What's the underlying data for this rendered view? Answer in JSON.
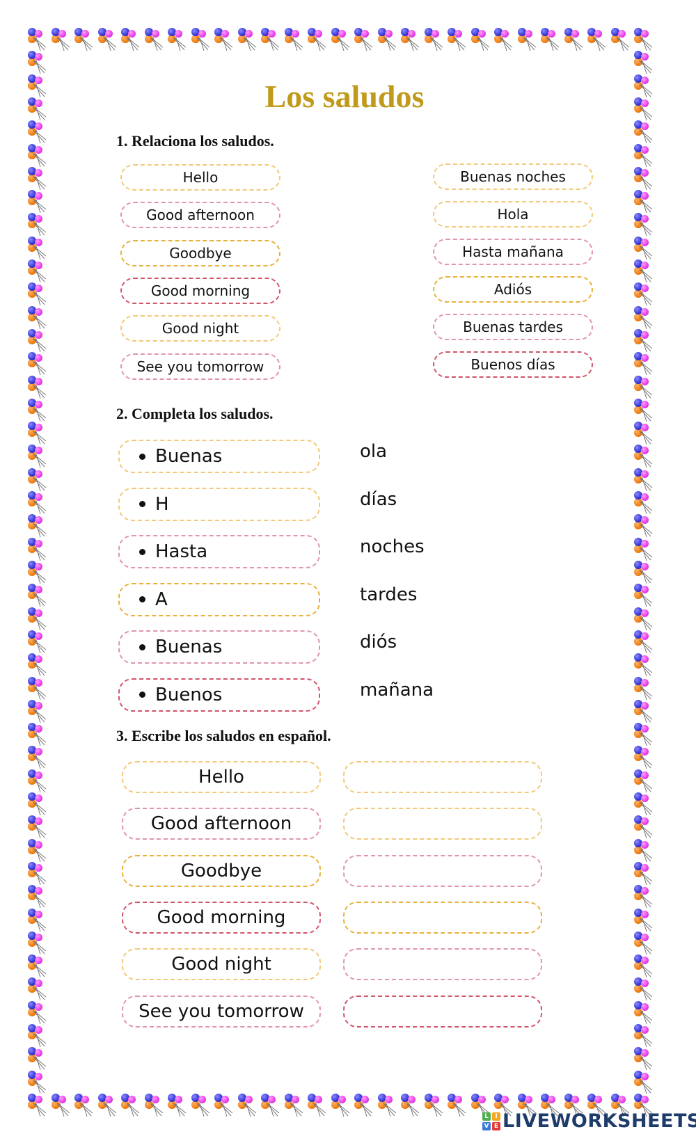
{
  "title": "Los saludos",
  "section1": {
    "heading": "1. Relaciona los saludos.",
    "left": [
      {
        "label": "Hello",
        "color": "yellow"
      },
      {
        "label": "Good afternoon",
        "color": "pink"
      },
      {
        "label": "Goodbye",
        "color": "gold"
      },
      {
        "label": "Good morning",
        "color": "red"
      },
      {
        "label": "Good night",
        "color": "yellow"
      },
      {
        "label": "See you tomorrow",
        "color": "pink"
      }
    ],
    "right": [
      {
        "label": "Buenas noches",
        "color": "yellow"
      },
      {
        "label": "Hola",
        "color": "yellow"
      },
      {
        "label": "Hasta mañana",
        "color": "pink"
      },
      {
        "label": "Adiós",
        "color": "gold"
      },
      {
        "label": "Buenas tardes",
        "color": "pink"
      },
      {
        "label": "Buenos días",
        "color": "red"
      }
    ]
  },
  "section2": {
    "heading": "2. Completa los saludos.",
    "prompts": [
      {
        "label": "Buenas",
        "color": "yellow"
      },
      {
        "label": "H",
        "color": "yellow"
      },
      {
        "label": "Hasta",
        "color": "pink"
      },
      {
        "label": "A",
        "color": "gold"
      },
      {
        "label": "Buenas",
        "color": "pink"
      },
      {
        "label": "Buenos",
        "color": "red"
      }
    ],
    "endings": [
      "ola",
      "días",
      "noches",
      "tardes",
      "diós",
      "mañana"
    ]
  },
  "section3": {
    "heading": "3. Escribe los saludos en español.",
    "rows": [
      {
        "label": "Hello",
        "color": "yellow",
        "answer": "",
        "answer_color": "yellow"
      },
      {
        "label": "Good afternoon",
        "color": "pink",
        "answer": "",
        "answer_color": "yellow"
      },
      {
        "label": "Goodbye",
        "color": "gold",
        "answer": "",
        "answer_color": "pink"
      },
      {
        "label": "Good morning",
        "color": "red",
        "answer": "",
        "answer_color": "gold"
      },
      {
        "label": "Good night",
        "color": "yellow",
        "answer": "",
        "answer_color": "pink"
      },
      {
        "label": "See you tomorrow",
        "color": "pink",
        "answer": "",
        "answer_color": "red"
      }
    ]
  },
  "border": {
    "icon": "balloon-icon"
  },
  "brand": {
    "name": "LIVEWORKSHEETS",
    "icon_letters": [
      "L",
      "I",
      "V",
      "E"
    ],
    "icon_colors": [
      "#4caf50",
      "#f5a623",
      "#3a7bd5",
      "#e53935"
    ],
    "text_color": "#1d3b6b"
  },
  "accent_colors": {
    "title": "#c19a1b",
    "yellow": "#f3c878",
    "gold": "#e8b038",
    "pink": "#e095a8",
    "red": "#d0546a"
  }
}
